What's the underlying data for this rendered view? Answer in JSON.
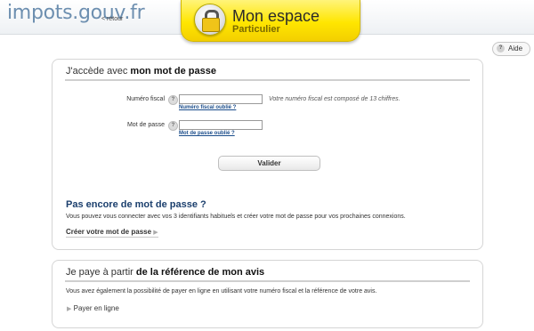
{
  "header": {
    "logo_text": "impots.gouv.fr",
    "back_link": "< retour",
    "espace_title": "Mon espace",
    "espace_subtitle": "Particulier",
    "help_label": "Aide",
    "help_hint": "?"
  },
  "login_panel": {
    "title_prefix": "J'accède avec ",
    "title_strong": "mon mot de passe",
    "fiscal_label": "Numéro fiscal",
    "fiscal_value": "",
    "fiscal_helper": "Votre numéro fiscal est composé de 13 chiffres.",
    "fiscal_forgot_link": "Numéro fiscal oublié ?",
    "password_label": "Mot de passe",
    "password_value": "",
    "password_forgot_link": "Mot de passe oublié ?",
    "hint": "?",
    "validate_button": "Valider",
    "no_password_heading": "Pas encore de mot de passe ?",
    "no_password_text": "Vous pouvez vous connecter avec vos 3 identifiants habituels et créer votre mot de passe pour vos prochaines connexions.",
    "create_link": "Créer votre mot de passe",
    "arrow": "▶"
  },
  "pay_panel": {
    "title_prefix": "Je paye à partir ",
    "title_strong": "de la référence de mon avis",
    "description": "Vous avez également la possibilité de payer en ligne en utilisant votre numéro fiscal et la référence de votre avis.",
    "pay_link": "Payer en ligne",
    "arrow": "▶"
  },
  "colors": {
    "banner_yellow": "#ffe600",
    "link_blue": "#1a4c8a",
    "heading_blue": "#1b3f6d",
    "logo_blue": "#6d8fb0"
  },
  "icons": {
    "lock": "lock-icon",
    "help": "question-icon",
    "arrow": "triangle-right-icon"
  }
}
